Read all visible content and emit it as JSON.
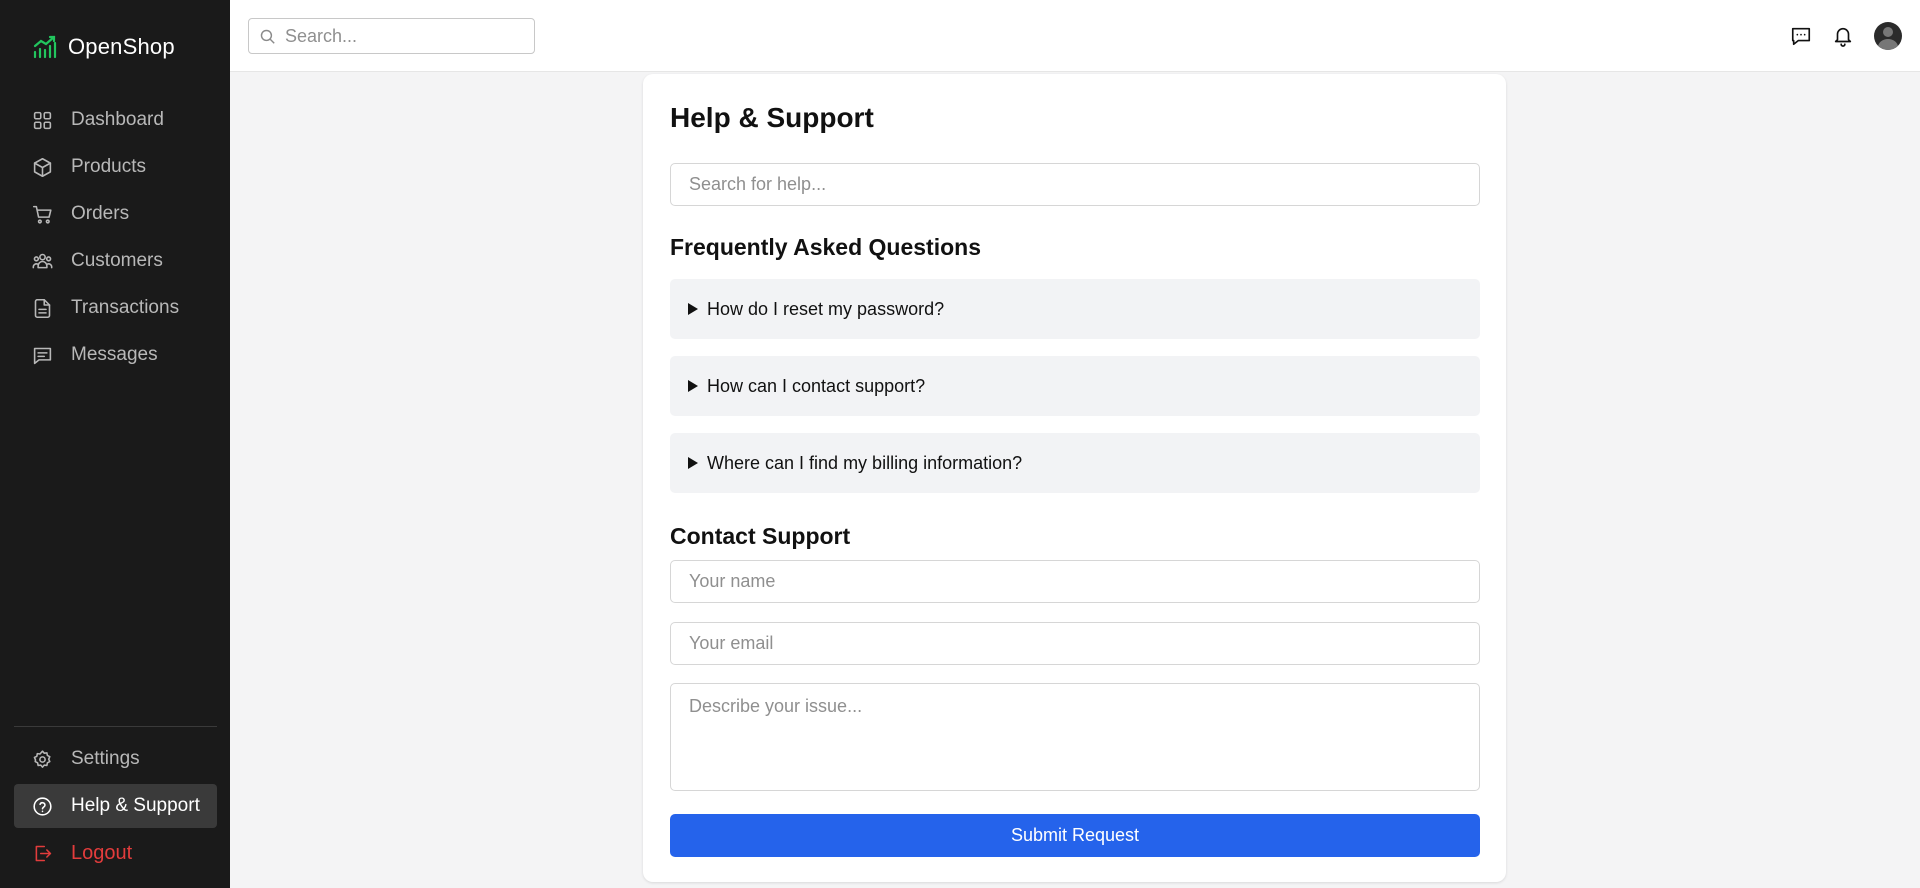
{
  "app": {
    "brand": "OpenShop",
    "accent": "#22c55e",
    "primary": "#2563eb",
    "danger": "#e23c3c"
  },
  "sidebar": {
    "items": [
      {
        "label": "Dashboard",
        "icon": "grid-icon"
      },
      {
        "label": "Products",
        "icon": "box-icon"
      },
      {
        "label": "Orders",
        "icon": "cart-icon"
      },
      {
        "label": "Customers",
        "icon": "users-icon"
      },
      {
        "label": "Transactions",
        "icon": "document-icon"
      },
      {
        "label": "Messages",
        "icon": "message-icon"
      }
    ],
    "bottom": {
      "settings": "Settings",
      "help": "Help & Support",
      "logout": "Logout"
    }
  },
  "topbar": {
    "search_placeholder": "Search..."
  },
  "main": {
    "title": "Help & Support",
    "search_placeholder": "Search for help...",
    "faq_title": "Frequently Asked Questions",
    "faqs": [
      "How do I reset my password?",
      "How can I contact support?",
      "Where can I find my billing information?"
    ],
    "contact_title": "Contact Support",
    "name_placeholder": "Your name",
    "email_placeholder": "Your email",
    "issue_placeholder": "Describe your issue...",
    "submit_label": "Submit Request"
  }
}
